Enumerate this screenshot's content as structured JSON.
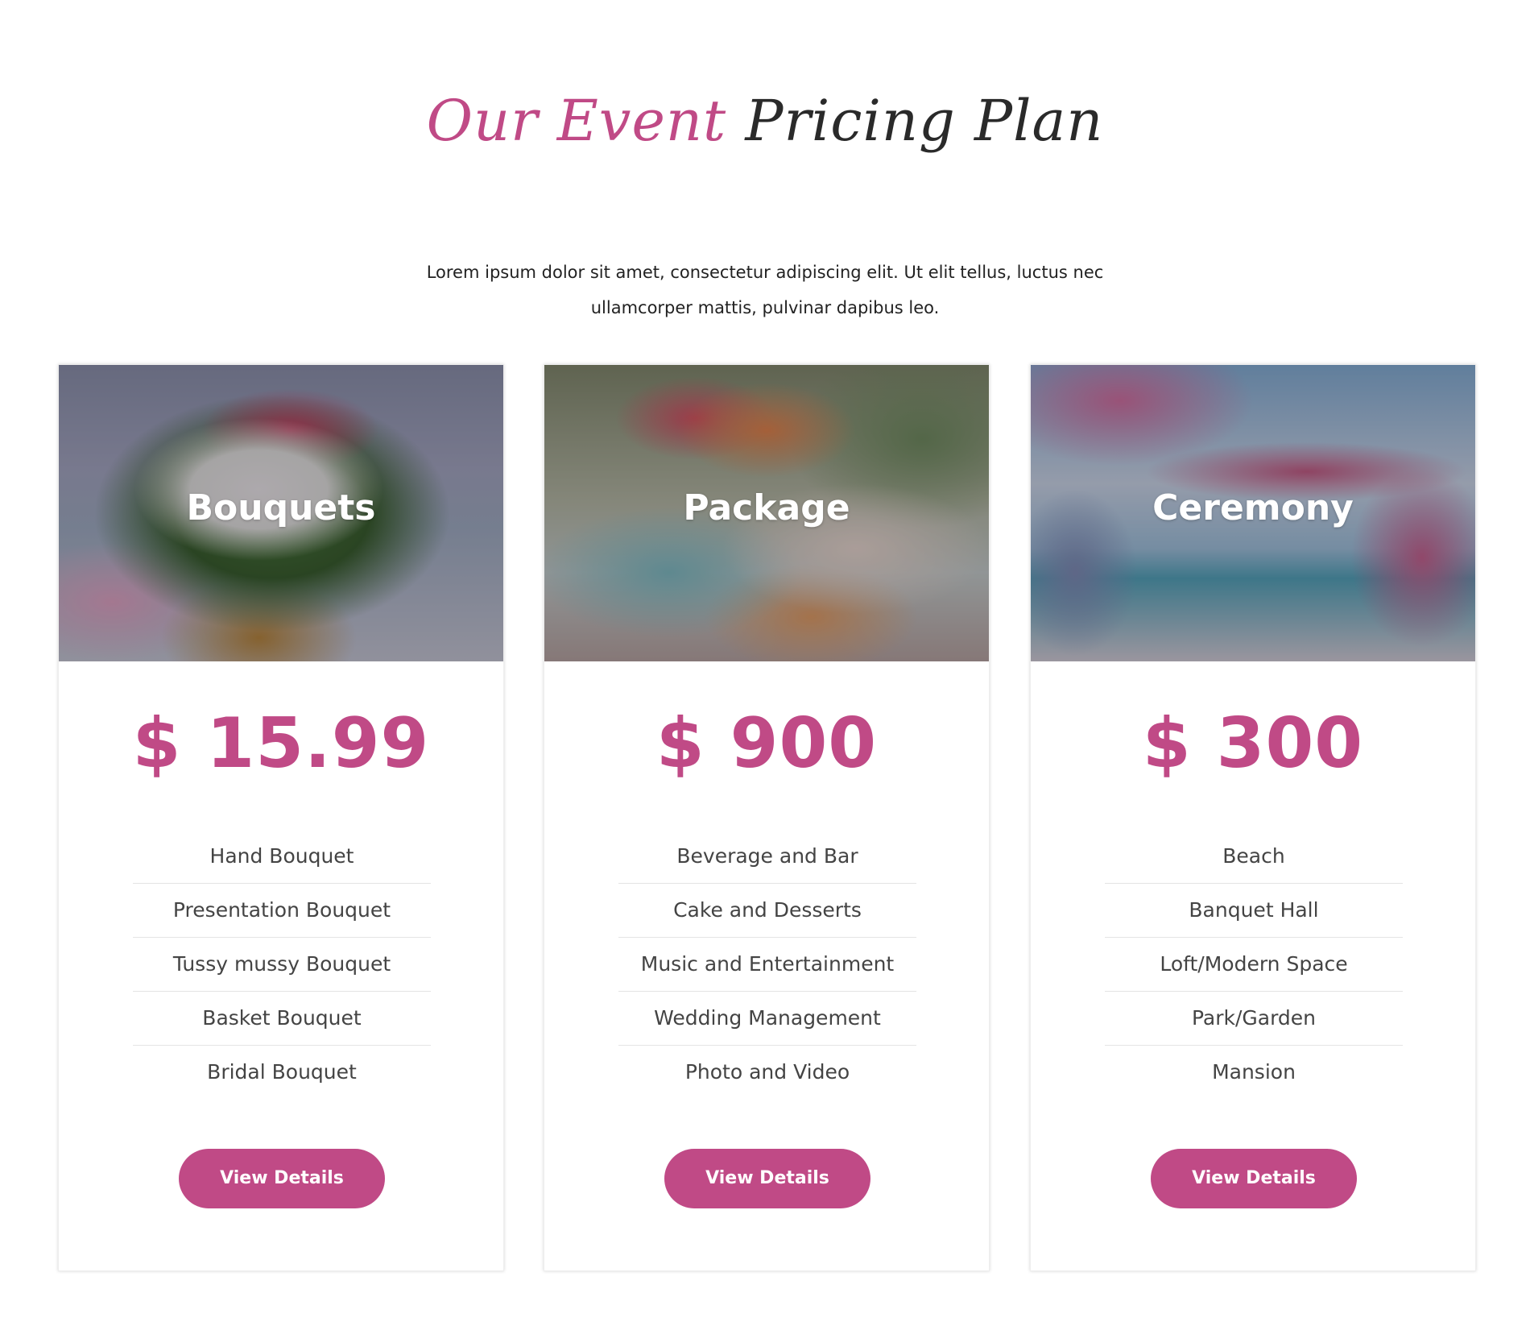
{
  "header": {
    "title_accent": "Our Event",
    "title_main": "Pricing Plan",
    "description": "Lorem ipsum dolor sit amet, consectetur adipiscing elit. Ut elit tellus, luctus nec ullamcorper mattis, pulvinar dapibus leo."
  },
  "colors": {
    "accent": "#c04a86",
    "text": "#444444",
    "heading": "#2a2a2a",
    "divider": "#e4e4e4"
  },
  "plans": [
    {
      "name": "Bouquets",
      "price": "$ 15.99",
      "image": "bouquet-photo",
      "features": [
        "Hand Bouquet",
        "Presentation Bouquet",
        "Tussy mussy Bouquet",
        "Basket Bouquet",
        "Bridal Bouquet"
      ],
      "button_label": "View Details"
    },
    {
      "name": "Package",
      "price": "$ 900",
      "image": "dessert-table-photo",
      "features": [
        "Beverage and Bar",
        "Cake and Desserts",
        "Music and Entertainment",
        "Wedding Management",
        "Photo and Video"
      ],
      "button_label": "View Details"
    },
    {
      "name": "Ceremony",
      "price": "$ 300",
      "image": "beach-ceremony-photo",
      "features": [
        "Beach",
        "Banquet Hall",
        "Loft/Modern Space",
        "Park/Garden",
        "Mansion"
      ],
      "button_label": "View Details"
    }
  ]
}
